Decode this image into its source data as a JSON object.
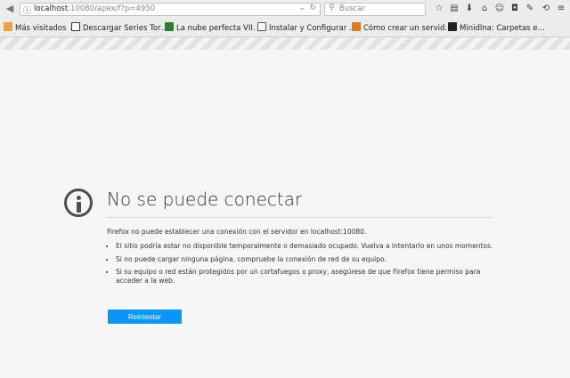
{
  "toolbar": {
    "url_host": "localhost",
    "url_path": ":10080/apex/f?p=4950",
    "search_placeholder": "Buscar"
  },
  "bookmarks": [
    {
      "label": "Más visitados ⌄",
      "color": "#e8a33d"
    },
    {
      "label": "Descargar Series Tor…",
      "color": "#333333"
    },
    {
      "label": "La nube perfecta VII. …",
      "color": "#2e7d32"
    },
    {
      "label": "Instalar y Configurar …",
      "color": "#555555"
    },
    {
      "label": "Cómo crear un servid…",
      "color": "#e07a1f"
    },
    {
      "label": "Minidlna: Carpetas e…",
      "color": "#222222"
    }
  ],
  "error": {
    "title": "No se puede conectar",
    "description": "Firefox no puede establecer una conexión con el servidor en localhost:10080.",
    "reasons": [
      "El sitio podría estar no disponible temporalmente o demasiado ocupado. Vuelva a intentarlo en unos momentos.",
      "Si no puede cargar ninguna página, compruebe la conexión de red de su equipo.",
      "Si su equipo o red están protegidos por un cortafuegos o proxy, asegúrese de que Firefox tiene permiso para acceder a la web."
    ],
    "retry_label": "Reintentar"
  },
  "colors": {
    "accent": "#0996f8",
    "icon": "#4a4e55"
  }
}
